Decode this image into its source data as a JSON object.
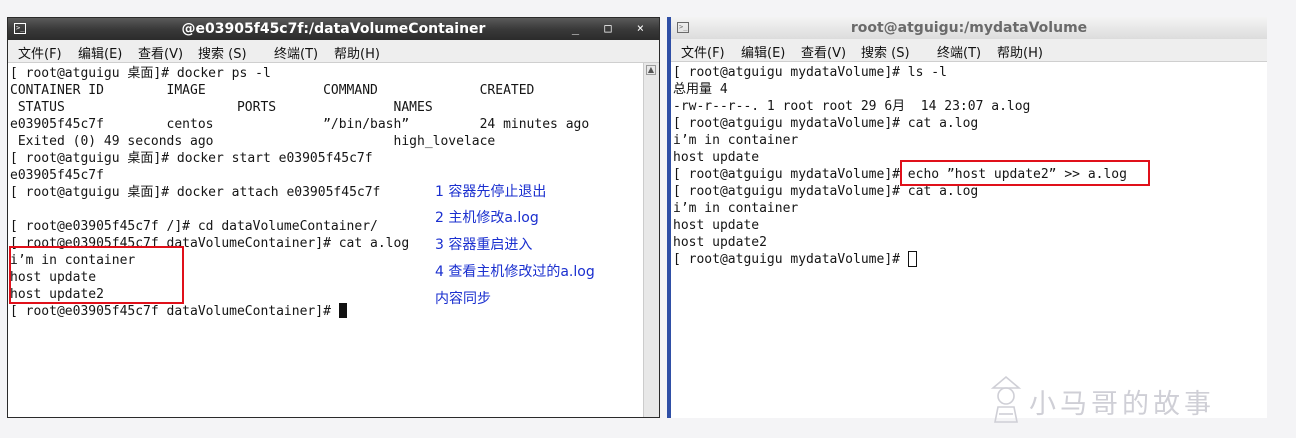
{
  "left_window": {
    "title": "@e03905f45c7f:/dataVolumeContainer",
    "controls": "_ □ ×",
    "menu": [
      "文件(F)",
      "编辑(E)",
      "查看(V)",
      "搜索 (S)",
      "终端(T)",
      "帮助(H)"
    ],
    "lines": [
      "[ root@atguigu 桌面]# docker ps -l",
      "CONTAINER ID        IMAGE               COMMAND             CREATED",
      " STATUS                      PORTS               NAMES",
      "e03905f45c7f        centos              ”/bin/bash”         24 minutes ago",
      " Exited (0) 49 seconds ago                       high_lovelace",
      "[ root@atguigu 桌面]# docker start e03905f45c7f",
      "e03905f45c7f",
      "[ root@atguigu 桌面]# docker attach e03905f45c7f",
      "",
      "[ root@e03905f45c7f /]# cd dataVolumeContainer/",
      "[ root@e03905f45c7f dataVolumeContainer]# cat a.log",
      "i’m in container",
      "host update",
      "host update2",
      "[ root@e03905f45c7f dataVolumeContainer]# "
    ]
  },
  "right_window": {
    "title": "root@atguigu:/mydataVolume",
    "menu": [
      "文件(F)",
      "编辑(E)",
      "查看(V)",
      "搜索 (S)",
      "终端(T)",
      "帮助(H)"
    ],
    "lines": [
      "[ root@atguigu mydataVolume]# ls -l",
      "总用量 4",
      "-rw-r--r--. 1 root root 29 6月  14 23:07 a.log",
      "[ root@atguigu mydataVolume]# cat a.log",
      "i’m in container",
      "host update",
      "[ root@atguigu mydataVolume]# echo ”host update2” >> a.log",
      "[ root@atguigu mydataVolume]# cat a.log",
      "i’m in container",
      "host update",
      "host update2",
      "[ root@atguigu mydataVolume]# "
    ]
  },
  "annotations": [
    "1 容器先停止退出",
    "2 主机修改a.log",
    "3 容器重启进入",
    "4 查看主机修改过的a.log",
    "内容同步"
  ],
  "watermark": "小马哥的故事",
  "colors": {
    "annotation_text": "#1a2fcf",
    "highlight_box": "#e0101a",
    "right_window_border": "#2f4fa6"
  },
  "icons": [
    "terminal-icon",
    "minimize-icon",
    "maximize-icon",
    "close-icon",
    "scroll-up-arrow-icon",
    "watermark-figure-icon"
  ]
}
